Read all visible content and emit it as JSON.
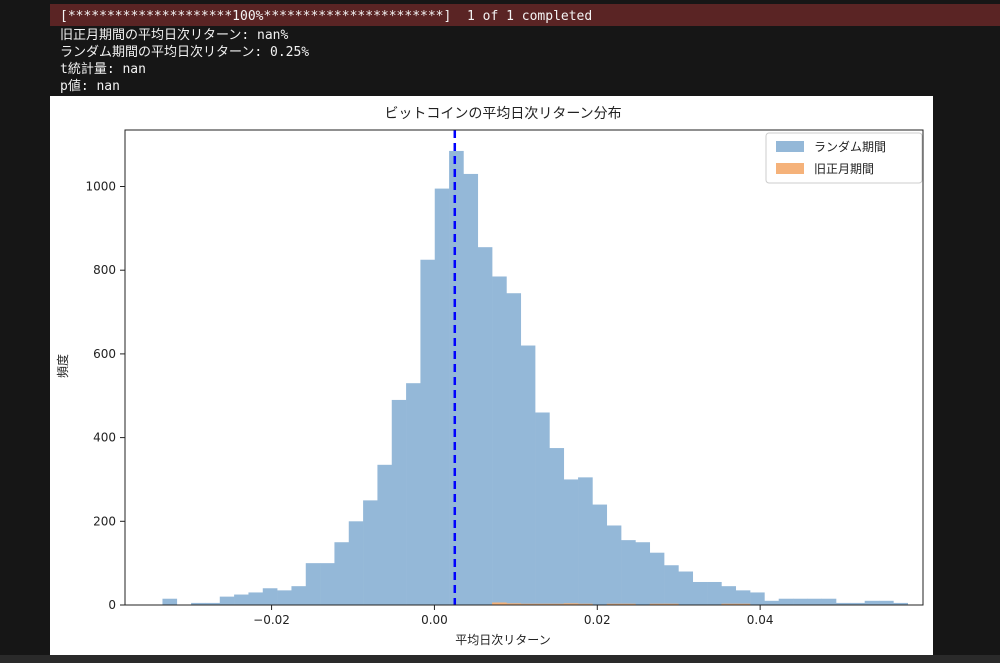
{
  "terminal": {
    "progress_line": "[*********************100%***********************]  1 of 1 completed",
    "lines": [
      "旧正月期間の平均日次リターン: nan%",
      "ランダム期間の平均日次リターン: 0.25%",
      "t統計量: nan",
      "p値: nan"
    ]
  },
  "colors": {
    "progress_bg": "#5a2424",
    "terminal_bg": "#161616",
    "terminal_text": "#f2f2f2",
    "series_random": "#94b8d8",
    "series_cny": "#f5b27a",
    "mean_line": "#0000ff"
  },
  "chart_data": {
    "type": "bar",
    "title": "ビットコインの平均日次リターン分布",
    "xlabel": "平均日次リターン",
    "ylabel": "頻度",
    "xlim": [
      -0.038,
      0.06
    ],
    "ylim": [
      0,
      1135
    ],
    "xticks": [
      -0.02,
      0.0,
      0.02,
      0.04
    ],
    "xtick_labels": [
      "−0.02",
      "0.00",
      "0.02",
      "0.04"
    ],
    "yticks": [
      0,
      200,
      400,
      600,
      800,
      1000
    ],
    "ytick_labels": [
      "0",
      "200",
      "400",
      "600",
      "800",
      "1000"
    ],
    "bin_edges_start": -0.0334,
    "bin_width": 0.00176,
    "series": [
      {
        "name": "ランダム期間",
        "values": [
          15,
          0,
          5,
          5,
          20,
          25,
          30,
          40,
          35,
          45,
          100,
          100,
          150,
          200,
          250,
          335,
          490,
          530,
          825,
          995,
          1085,
          1030,
          855,
          785,
          745,
          620,
          460,
          375,
          300,
          305,
          240,
          190,
          155,
          150,
          125,
          95,
          80,
          55,
          55,
          45,
          35,
          30,
          10,
          15,
          15,
          15,
          15,
          5,
          5,
          10,
          10,
          5,
          0,
          0,
          0,
          0,
          5,
          5,
          0,
          5
        ]
      },
      {
        "name": "旧正月期間",
        "values": [
          0,
          0,
          0,
          0,
          0,
          0,
          0,
          0,
          0,
          0,
          0,
          0,
          0,
          0,
          0,
          0,
          0,
          0,
          0,
          0,
          0,
          0,
          0,
          6,
          4,
          3,
          3,
          3,
          4,
          3,
          0,
          3,
          3,
          0,
          3,
          3,
          0,
          0,
          0,
          3,
          3,
          0,
          0,
          0,
          0,
          0,
          0,
          0,
          0,
          0,
          0,
          0,
          0,
          0,
          0,
          0,
          0,
          0,
          0,
          0
        ]
      }
    ],
    "vline": {
      "x": 0.0025,
      "style": "dashed"
    },
    "legend": "top-right",
    "grid": false
  }
}
